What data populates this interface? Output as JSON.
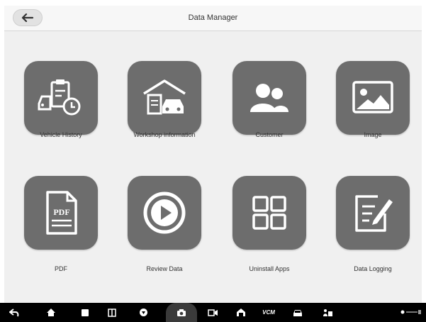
{
  "header": {
    "title": "Data Manager"
  },
  "tiles": [
    {
      "label": "Vehicle History"
    },
    {
      "label": "Workshop information"
    },
    {
      "label": "Customer"
    },
    {
      "label": "Image"
    },
    {
      "label": "PDF",
      "icon_text": "PDF"
    },
    {
      "label": "Review Data"
    },
    {
      "label": "Uninstall Apps"
    },
    {
      "label": "Data Logging"
    }
  ],
  "navbar": {
    "vcm_label": "VCM"
  },
  "colors": {
    "tile": "#6d6d6d",
    "navbar": "#000000",
    "screen_bg": "#f0f0f0"
  }
}
